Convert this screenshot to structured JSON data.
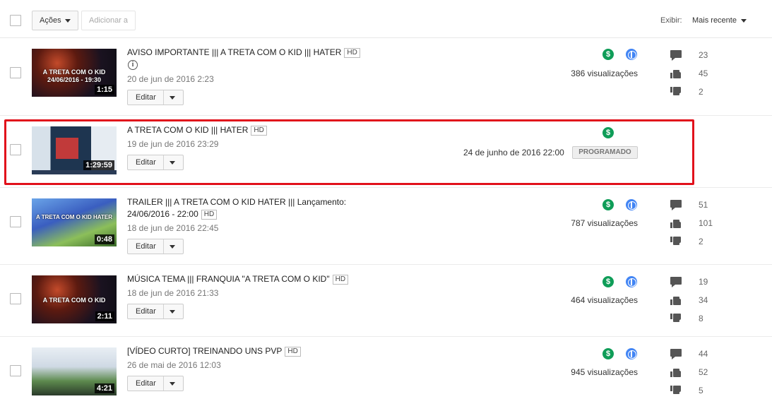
{
  "toolbar": {
    "acoes_label": "Ações",
    "adicionar_label": "Adicionar a",
    "exibir_label": "Exibir:",
    "sort_label": "Mais recente"
  },
  "videos": [
    {
      "title": "AVISO IMPORTANTE ||| A TRETA COM O KID ||| HATER",
      "hd": "HD",
      "date": "20 de jun de 2016 2:23",
      "duration": "1:15",
      "thumb_text": "A TRETA COM O KID\n24/06/2016 - 19:30",
      "edit_label": "Editar",
      "views": "386 visualizações",
      "comments": "23",
      "likes": "45",
      "dislikes": "2"
    },
    {
      "title": "A TRETA COM O KID ||| HATER",
      "hd": "HD",
      "date": "19 de jun de 2016 23:29",
      "duration": "1:29:59",
      "edit_label": "Editar",
      "scheduled_date": "24 de junho de 2016 22:00",
      "status": "PROGRAMADO"
    },
    {
      "title_line1": "TRAILER ||| A TRETA COM O KID HATER ||| Lançamento:",
      "title_line2": "24/06/2016 - 22:00",
      "hd": "HD",
      "date": "18 de jun de 2016 22:45",
      "duration": "0:48",
      "edit_label": "Editar",
      "views": "787 visualizações",
      "comments": "51",
      "likes": "101",
      "dislikes": "2"
    },
    {
      "title": "MÚSICA TEMA ||| FRANQUIA \"A TRETA COM O KID\"",
      "hd": "HD",
      "date": "18 de jun de 2016 21:33",
      "duration": "2:11",
      "thumb_text": "A TRETA COM O KID",
      "edit_label": "Editar",
      "views": "464 visualizações",
      "comments": "19",
      "likes": "34",
      "dislikes": "8"
    },
    {
      "title": "[VÍDEO CURTO] TREINANDO UNS PVP",
      "hd": "HD",
      "date": "26 de mai de 2016 12:03",
      "duration": "4:21",
      "edit_label": "Editar",
      "views": "945 visualizações",
      "comments": "44",
      "likes": "52",
      "dislikes": "5"
    }
  ],
  "colors": {
    "monetization": "#0f9d58",
    "public": "#4285f4",
    "highlight": "#e1111b"
  },
  "icons": [
    "checkbox",
    "caret-down-icon",
    "info-icon",
    "monetization-icon",
    "globe-icon",
    "comment-icon",
    "thumbs-up-icon",
    "thumbs-down-icon"
  ]
}
